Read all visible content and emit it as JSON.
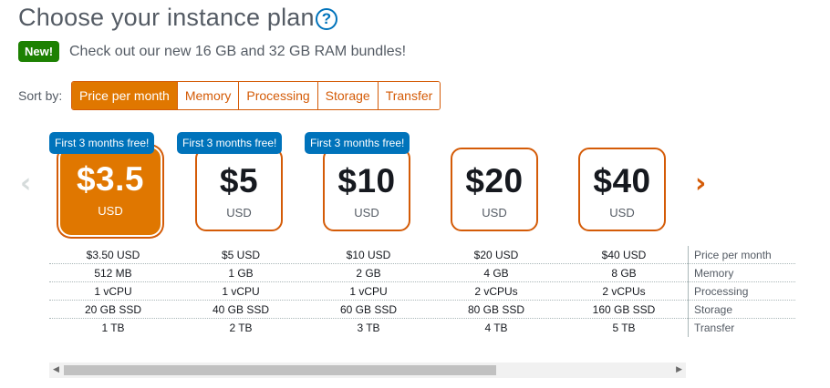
{
  "header": {
    "title": "Choose your instance plan",
    "help_icon": "?"
  },
  "announcement": {
    "badge": "New!",
    "text": "Check out our new 16 GB and 32 GB RAM bundles!"
  },
  "sort": {
    "label": "Sort by:",
    "options": [
      "Price per month",
      "Memory",
      "Processing",
      "Storage",
      "Transfer"
    ],
    "selected": "Price per month"
  },
  "nav": {
    "prev_icon": "chevron-left-icon",
    "next_icon": "chevron-right-icon",
    "prev_glyph": "‹",
    "next_glyph": "›"
  },
  "plans": [
    {
      "price": "$3.5",
      "currency": "USD",
      "promo": "First 3 months free!",
      "selected": true,
      "price_month": "$3.50 USD",
      "memory": "512 MB",
      "processing": "1 vCPU",
      "storage": "20 GB SSD",
      "transfer": "1 TB"
    },
    {
      "price": "$5",
      "currency": "USD",
      "promo": "First 3 months free!",
      "selected": false,
      "price_month": "$5 USD",
      "memory": "1 GB",
      "processing": "1 vCPU",
      "storage": "40 GB SSD",
      "transfer": "2 TB"
    },
    {
      "price": "$10",
      "currency": "USD",
      "promo": "First 3 months free!",
      "selected": false,
      "price_month": "$10 USD",
      "memory": "2 GB",
      "processing": "1 vCPU",
      "storage": "60 GB SSD",
      "transfer": "3 TB"
    },
    {
      "price": "$20",
      "currency": "USD",
      "promo": "",
      "selected": false,
      "price_month": "$20 USD",
      "memory": "4 GB",
      "processing": "2 vCPUs",
      "storage": "80 GB SSD",
      "transfer": "4 TB"
    },
    {
      "price": "$40",
      "currency": "USD",
      "promo": "",
      "selected": false,
      "price_month": "$40 USD",
      "memory": "8 GB",
      "processing": "2 vCPUs",
      "storage": "160 GB SSD",
      "transfer": "5 TB"
    }
  ],
  "spec_labels": {
    "price_month": "Price per month",
    "memory": "Memory",
    "processing": "Processing",
    "storage": "Storage",
    "transfer": "Transfer"
  },
  "scrollbar": {
    "position_fraction": 0.0,
    "visible_fraction": 0.71
  },
  "colors": {
    "accent": "#e07700",
    "accent_dark": "#d45b07",
    "promo": "#0073bb",
    "new_badge": "#1d8102"
  }
}
